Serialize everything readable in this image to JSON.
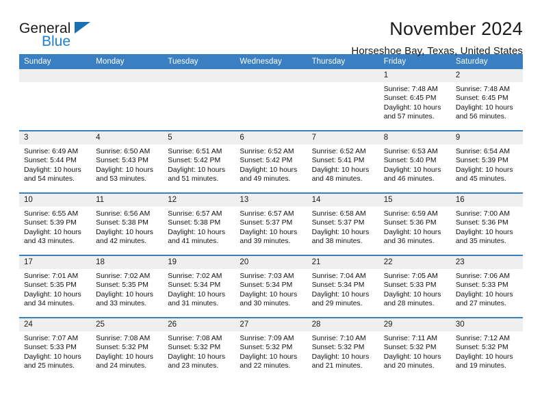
{
  "brand": {
    "line1": "General",
    "line2": "Blue",
    "triangle_color": "#1b6fb5"
  },
  "header": {
    "title": "November 2024",
    "subtitle": "Horseshoe Bay, Texas, United States"
  },
  "theme": {
    "header_blue": "#3a7fc1",
    "daynum_gray": "#efefef",
    "text": "#111111"
  },
  "weekdays": [
    "Sunday",
    "Monday",
    "Tuesday",
    "Wednesday",
    "Thursday",
    "Friday",
    "Saturday"
  ],
  "labels": {
    "sunrise_prefix": "Sunrise: ",
    "sunset_prefix": "Sunset: ",
    "daylight_prefix": "Daylight: "
  },
  "weeks": [
    [
      {
        "empty": true
      },
      {
        "empty": true
      },
      {
        "empty": true
      },
      {
        "empty": true
      },
      {
        "empty": true
      },
      {
        "day": "1",
        "sunrise": "Sunrise: 7:48 AM",
        "sunset": "Sunset: 6:45 PM",
        "daylight_line1": "Daylight: 10 hours",
        "daylight_line2": "and 57 minutes."
      },
      {
        "day": "2",
        "sunrise": "Sunrise: 7:48 AM",
        "sunset": "Sunset: 6:45 PM",
        "daylight_line1": "Daylight: 10 hours",
        "daylight_line2": "and 56 minutes."
      }
    ],
    [
      {
        "day": "3",
        "sunrise": "Sunrise: 6:49 AM",
        "sunset": "Sunset: 5:44 PM",
        "daylight_line1": "Daylight: 10 hours",
        "daylight_line2": "and 54 minutes."
      },
      {
        "day": "4",
        "sunrise": "Sunrise: 6:50 AM",
        "sunset": "Sunset: 5:43 PM",
        "daylight_line1": "Daylight: 10 hours",
        "daylight_line2": "and 53 minutes."
      },
      {
        "day": "5",
        "sunrise": "Sunrise: 6:51 AM",
        "sunset": "Sunset: 5:42 PM",
        "daylight_line1": "Daylight: 10 hours",
        "daylight_line2": "and 51 minutes."
      },
      {
        "day": "6",
        "sunrise": "Sunrise: 6:52 AM",
        "sunset": "Sunset: 5:42 PM",
        "daylight_line1": "Daylight: 10 hours",
        "daylight_line2": "and 49 minutes."
      },
      {
        "day": "7",
        "sunrise": "Sunrise: 6:52 AM",
        "sunset": "Sunset: 5:41 PM",
        "daylight_line1": "Daylight: 10 hours",
        "daylight_line2": "and 48 minutes."
      },
      {
        "day": "8",
        "sunrise": "Sunrise: 6:53 AM",
        "sunset": "Sunset: 5:40 PM",
        "daylight_line1": "Daylight: 10 hours",
        "daylight_line2": "and 46 minutes."
      },
      {
        "day": "9",
        "sunrise": "Sunrise: 6:54 AM",
        "sunset": "Sunset: 5:39 PM",
        "daylight_line1": "Daylight: 10 hours",
        "daylight_line2": "and 45 minutes."
      }
    ],
    [
      {
        "day": "10",
        "sunrise": "Sunrise: 6:55 AM",
        "sunset": "Sunset: 5:39 PM",
        "daylight_line1": "Daylight: 10 hours",
        "daylight_line2": "and 43 minutes."
      },
      {
        "day": "11",
        "sunrise": "Sunrise: 6:56 AM",
        "sunset": "Sunset: 5:38 PM",
        "daylight_line1": "Daylight: 10 hours",
        "daylight_line2": "and 42 minutes."
      },
      {
        "day": "12",
        "sunrise": "Sunrise: 6:57 AM",
        "sunset": "Sunset: 5:38 PM",
        "daylight_line1": "Daylight: 10 hours",
        "daylight_line2": "and 41 minutes."
      },
      {
        "day": "13",
        "sunrise": "Sunrise: 6:57 AM",
        "sunset": "Sunset: 5:37 PM",
        "daylight_line1": "Daylight: 10 hours",
        "daylight_line2": "and 39 minutes."
      },
      {
        "day": "14",
        "sunrise": "Sunrise: 6:58 AM",
        "sunset": "Sunset: 5:37 PM",
        "daylight_line1": "Daylight: 10 hours",
        "daylight_line2": "and 38 minutes."
      },
      {
        "day": "15",
        "sunrise": "Sunrise: 6:59 AM",
        "sunset": "Sunset: 5:36 PM",
        "daylight_line1": "Daylight: 10 hours",
        "daylight_line2": "and 36 minutes."
      },
      {
        "day": "16",
        "sunrise": "Sunrise: 7:00 AM",
        "sunset": "Sunset: 5:36 PM",
        "daylight_line1": "Daylight: 10 hours",
        "daylight_line2": "and 35 minutes."
      }
    ],
    [
      {
        "day": "17",
        "sunrise": "Sunrise: 7:01 AM",
        "sunset": "Sunset: 5:35 PM",
        "daylight_line1": "Daylight: 10 hours",
        "daylight_line2": "and 34 minutes."
      },
      {
        "day": "18",
        "sunrise": "Sunrise: 7:02 AM",
        "sunset": "Sunset: 5:35 PM",
        "daylight_line1": "Daylight: 10 hours",
        "daylight_line2": "and 33 minutes."
      },
      {
        "day": "19",
        "sunrise": "Sunrise: 7:02 AM",
        "sunset": "Sunset: 5:34 PM",
        "daylight_line1": "Daylight: 10 hours",
        "daylight_line2": "and 31 minutes."
      },
      {
        "day": "20",
        "sunrise": "Sunrise: 7:03 AM",
        "sunset": "Sunset: 5:34 PM",
        "daylight_line1": "Daylight: 10 hours",
        "daylight_line2": "and 30 minutes."
      },
      {
        "day": "21",
        "sunrise": "Sunrise: 7:04 AM",
        "sunset": "Sunset: 5:34 PM",
        "daylight_line1": "Daylight: 10 hours",
        "daylight_line2": "and 29 minutes."
      },
      {
        "day": "22",
        "sunrise": "Sunrise: 7:05 AM",
        "sunset": "Sunset: 5:33 PM",
        "daylight_line1": "Daylight: 10 hours",
        "daylight_line2": "and 28 minutes."
      },
      {
        "day": "23",
        "sunrise": "Sunrise: 7:06 AM",
        "sunset": "Sunset: 5:33 PM",
        "daylight_line1": "Daylight: 10 hours",
        "daylight_line2": "and 27 minutes."
      }
    ],
    [
      {
        "day": "24",
        "sunrise": "Sunrise: 7:07 AM",
        "sunset": "Sunset: 5:33 PM",
        "daylight_line1": "Daylight: 10 hours",
        "daylight_line2": "and 25 minutes."
      },
      {
        "day": "25",
        "sunrise": "Sunrise: 7:08 AM",
        "sunset": "Sunset: 5:32 PM",
        "daylight_line1": "Daylight: 10 hours",
        "daylight_line2": "and 24 minutes."
      },
      {
        "day": "26",
        "sunrise": "Sunrise: 7:08 AM",
        "sunset": "Sunset: 5:32 PM",
        "daylight_line1": "Daylight: 10 hours",
        "daylight_line2": "and 23 minutes."
      },
      {
        "day": "27",
        "sunrise": "Sunrise: 7:09 AM",
        "sunset": "Sunset: 5:32 PM",
        "daylight_line1": "Daylight: 10 hours",
        "daylight_line2": "and 22 minutes."
      },
      {
        "day": "28",
        "sunrise": "Sunrise: 7:10 AM",
        "sunset": "Sunset: 5:32 PM",
        "daylight_line1": "Daylight: 10 hours",
        "daylight_line2": "and 21 minutes."
      },
      {
        "day": "29",
        "sunrise": "Sunrise: 7:11 AM",
        "sunset": "Sunset: 5:32 PM",
        "daylight_line1": "Daylight: 10 hours",
        "daylight_line2": "and 20 minutes."
      },
      {
        "day": "30",
        "sunrise": "Sunrise: 7:12 AM",
        "sunset": "Sunset: 5:32 PM",
        "daylight_line1": "Daylight: 10 hours",
        "daylight_line2": "and 19 minutes."
      }
    ]
  ]
}
